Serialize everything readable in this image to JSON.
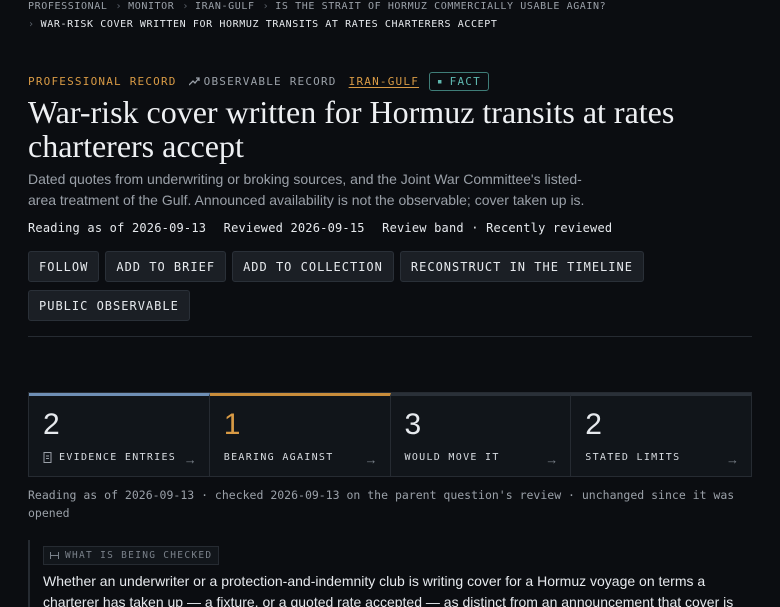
{
  "breadcrumb": {
    "items": [
      "PROFESSIONAL",
      "MONITOR",
      "IRAN-GULF",
      "IS THE STRAIT OF HORMUZ COMMERCIALLY USABLE AGAIN?"
    ],
    "current": "WAR-RISK COVER WRITTEN FOR HORMUZ TRANSITS AT RATES CHARTERERS ACCEPT"
  },
  "tags": {
    "professional": "PROFESSIONAL RECORD",
    "observable": "OBSERVABLE RECORD",
    "region": "IRAN-GULF",
    "fact": "FACT"
  },
  "title": "War-risk cover written for Hormuz transits at rates charterers accept",
  "description": "Dated quotes from underwriting or broking sources, and the Joint War Committee's listed-area treatment of the Gulf. Announced availability is not the observable; cover taken up is.",
  "meta": {
    "reading": "Reading as of 2026-09-13",
    "reviewed": "Reviewed 2026-09-15",
    "band": "Review band · Recently reviewed"
  },
  "actions": [
    "FOLLOW",
    "ADD TO BRIEF",
    "ADD TO COLLECTION",
    "RECONSTRUCT IN THE TIMELINE",
    "PUBLIC OBSERVABLE"
  ],
  "stats": [
    {
      "value": "2",
      "label": "EVIDENCE ENTRIES",
      "arrow": "→"
    },
    {
      "value": "1",
      "label": "BEARING AGAINST",
      "arrow": "→"
    },
    {
      "value": "3",
      "label": "WOULD MOVE IT",
      "arrow": "→"
    },
    {
      "value": "2",
      "label": "STATED LIMITS",
      "arrow": "→"
    }
  ],
  "reading_note": "Reading as of 2026-09-13 · checked 2026-09-13 on the parent question's review · unchanged since it was opened",
  "check": {
    "label": "WHAT IS BEING CHECKED",
    "body": "Whether an underwriter or a protection-and-indemnity club is writing cover for a Hormuz voyage on terms a charterer has taken up — a fixture, or a quoted rate accepted — as distinct from an announcement that cover is available. The Joint War"
  },
  "colors": {
    "background": "#0b0d11",
    "accent_amber": "#d89a45",
    "accent_teal": "#5fb8b0",
    "accent_blue": "#6f8fb5"
  }
}
